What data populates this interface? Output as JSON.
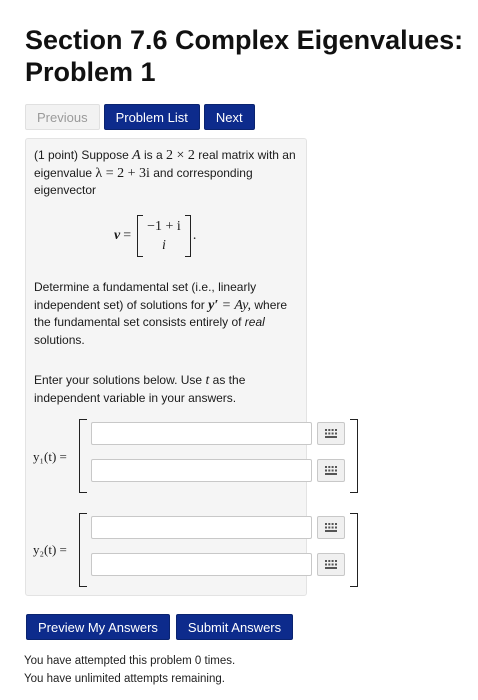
{
  "page": {
    "title": "Section 7.6 Complex Eigenvalues: Problem 1"
  },
  "nav": {
    "previous_label": "Previous",
    "problem_list_label": "Problem List",
    "next_label": "Next"
  },
  "problem": {
    "points": "(1 point)",
    "intro_a": "Suppose",
    "var_A": "A",
    "intro_b": "is a",
    "dims": "2 × 2",
    "intro_c": "real matrix with an eigenvalue",
    "eigenvalue": "λ = 2 + 3i",
    "intro_d": "and corresponding eigenvector",
    "vector_name": "v",
    "vector_entries": [
      "−1 + i",
      "i"
    ],
    "determine_a": "Determine a fundamental set (i.e., linearly independent set) of solutions for",
    "ode_lhs": "y′",
    "ode_rhs": "= Ay,",
    "determine_b": "where the fundamental set consists entirely of",
    "real_word": "real",
    "determine_c": "solutions.",
    "enter_a": "Enter your solutions below. Use",
    "var_t": "t",
    "enter_b": "as the independent variable in your answers.",
    "answers": [
      {
        "label": "y₁(t) =",
        "fields": [
          "",
          ""
        ]
      },
      {
        "label": "y₂(t) =",
        "fields": [
          "",
          ""
        ]
      }
    ]
  },
  "actions": {
    "preview_label": "Preview My Answers",
    "submit_label": "Submit Answers"
  },
  "footer": {
    "attempts": "You have attempted this problem 0 times.",
    "remaining": "You have unlimited attempts remaining."
  },
  "icons": {
    "keyboard": "keyboard-grid-icon"
  }
}
